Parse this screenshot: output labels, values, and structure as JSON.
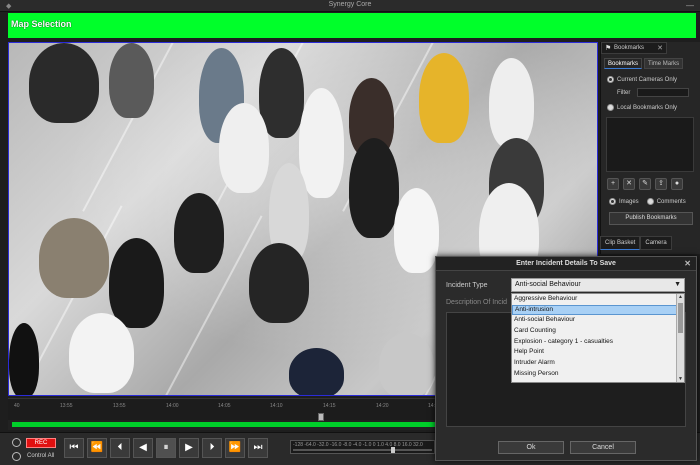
{
  "window": {
    "title": "Synergy Core"
  },
  "map_banner": {
    "label": "Map Selection",
    "color": "#00ff2a"
  },
  "side_panel": {
    "tab_label": "Bookmarks",
    "subtabs": [
      "Bookmarks",
      "Time Marks"
    ],
    "radio_current": "Current Cameras Only",
    "filter_label": "Filter",
    "radio_local": "Local Bookmarks Only",
    "images_label": "Images",
    "comments_label": "Comments",
    "publish_label": "Publish Bookmarks"
  },
  "clip_tabs": [
    "Clip Basket",
    "Camera"
  ],
  "timeline": {
    "ticks": [
      "40",
      "13:55",
      "13:55",
      "14:00",
      "14:05",
      "14:10",
      "14:15",
      "14:20",
      "14:25"
    ],
    "bar_color": "#00d02a"
  },
  "controls": {
    "rec_label": "REC",
    "control_all_label": "Control All",
    "speed_scale": "-128 -64.0 -32.0 -16.0 -8.0 -4.0 -1.0 0 1.0 4.0 8.0 16.0 32.0"
  },
  "dialog": {
    "title": "Enter Incident Details To Save",
    "incident_type_label": "Incident Type",
    "description_label": "Description Of Incid",
    "selected_value": "Anti-social Behaviour",
    "options": [
      "Aggressive Behaviour",
      "Anti-intrusion",
      "Anti-social Behaviour",
      "Card Counting",
      "Explosion - category 1 - casualties",
      "Help Point",
      "Intruder Alarm",
      "Missing Person"
    ],
    "highlighted_index": 1,
    "ok_label": "Ok",
    "cancel_label": "Cancel"
  }
}
